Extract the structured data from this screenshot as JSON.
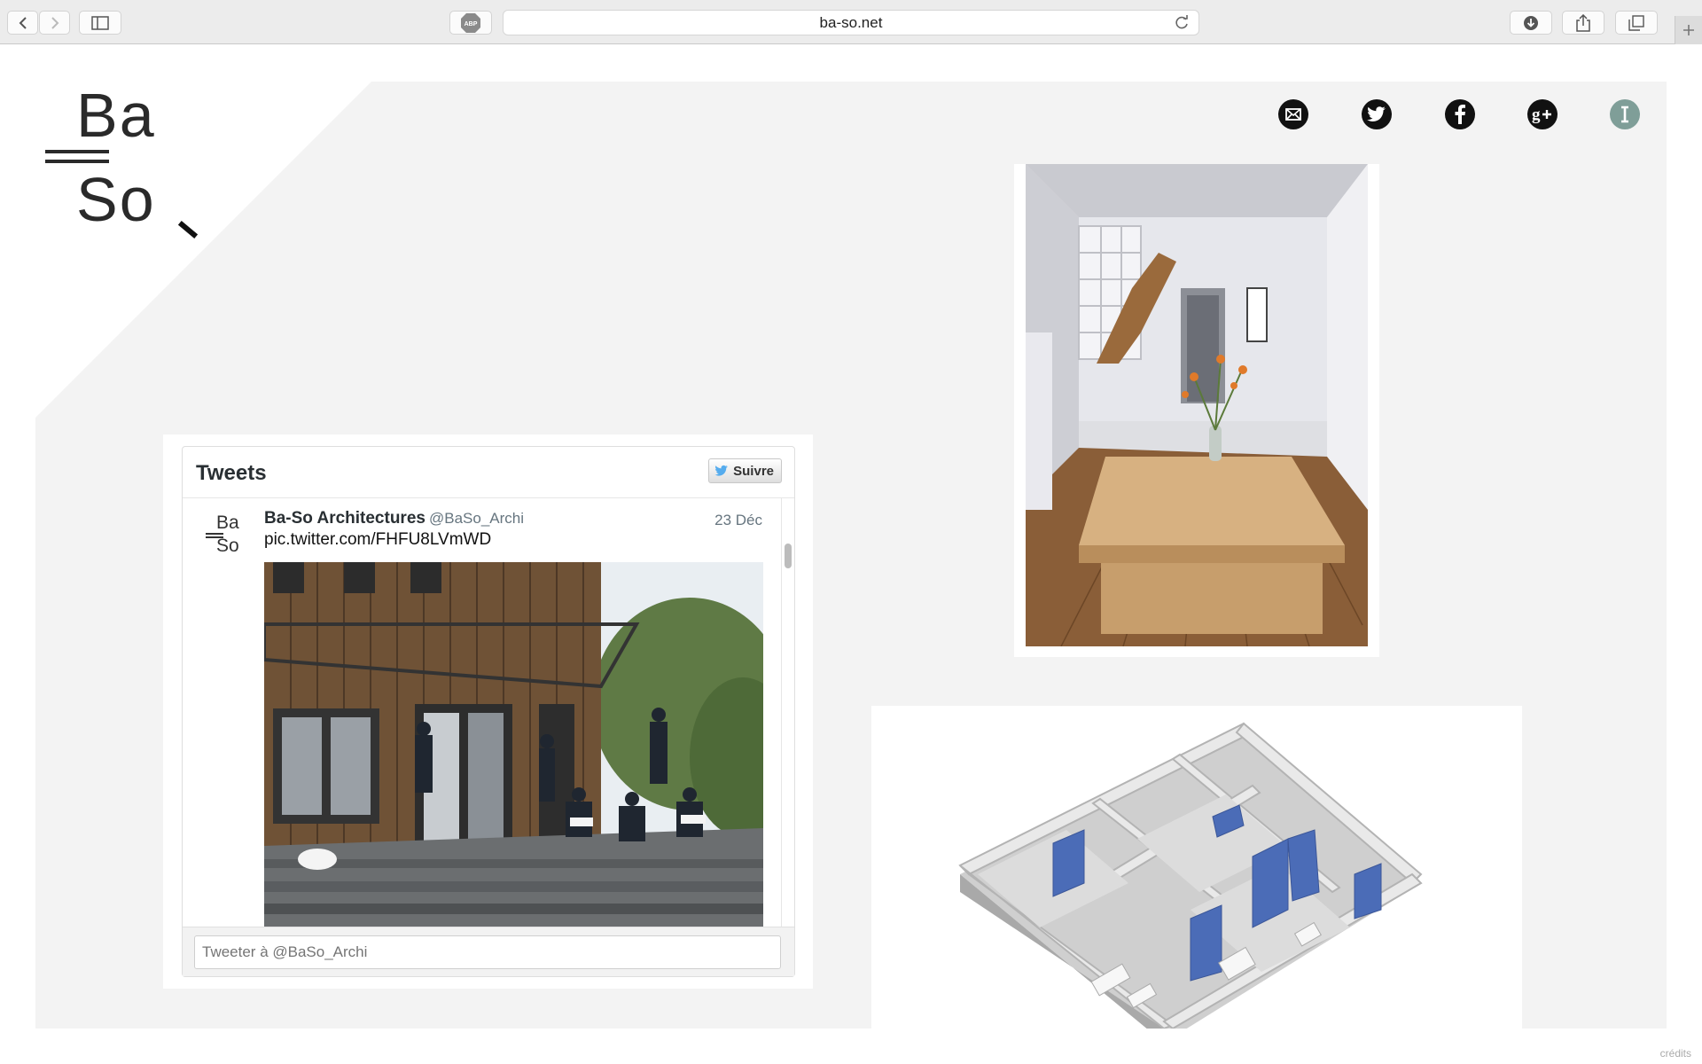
{
  "browser": {
    "url": "ba-so.net",
    "adblock_label": "ABP"
  },
  "logo": {
    "top": "Ba",
    "bottom": "So"
  },
  "social": [
    "mail-icon",
    "twitter-icon",
    "facebook-icon",
    "google-plus-icon",
    "info-icon"
  ],
  "twitter": {
    "title": "Tweets",
    "follow_label": "Suivre",
    "tweet": {
      "avatar_top": "Ba",
      "avatar_bottom": "So",
      "name": "Ba-So Architectures",
      "handle": "@BaSo_Archi",
      "date": "23 Déc",
      "text": "pic.twitter.com/FHFU8LVmWD"
    },
    "compose_placeholder": "Tweeter à @BaSo_Archi"
  },
  "footer": {
    "credits": "crédits"
  },
  "colors": {
    "panel": "#f3f3f3",
    "info_icon": "#7f9e98",
    "plan_accent": "#4b6cb7"
  }
}
